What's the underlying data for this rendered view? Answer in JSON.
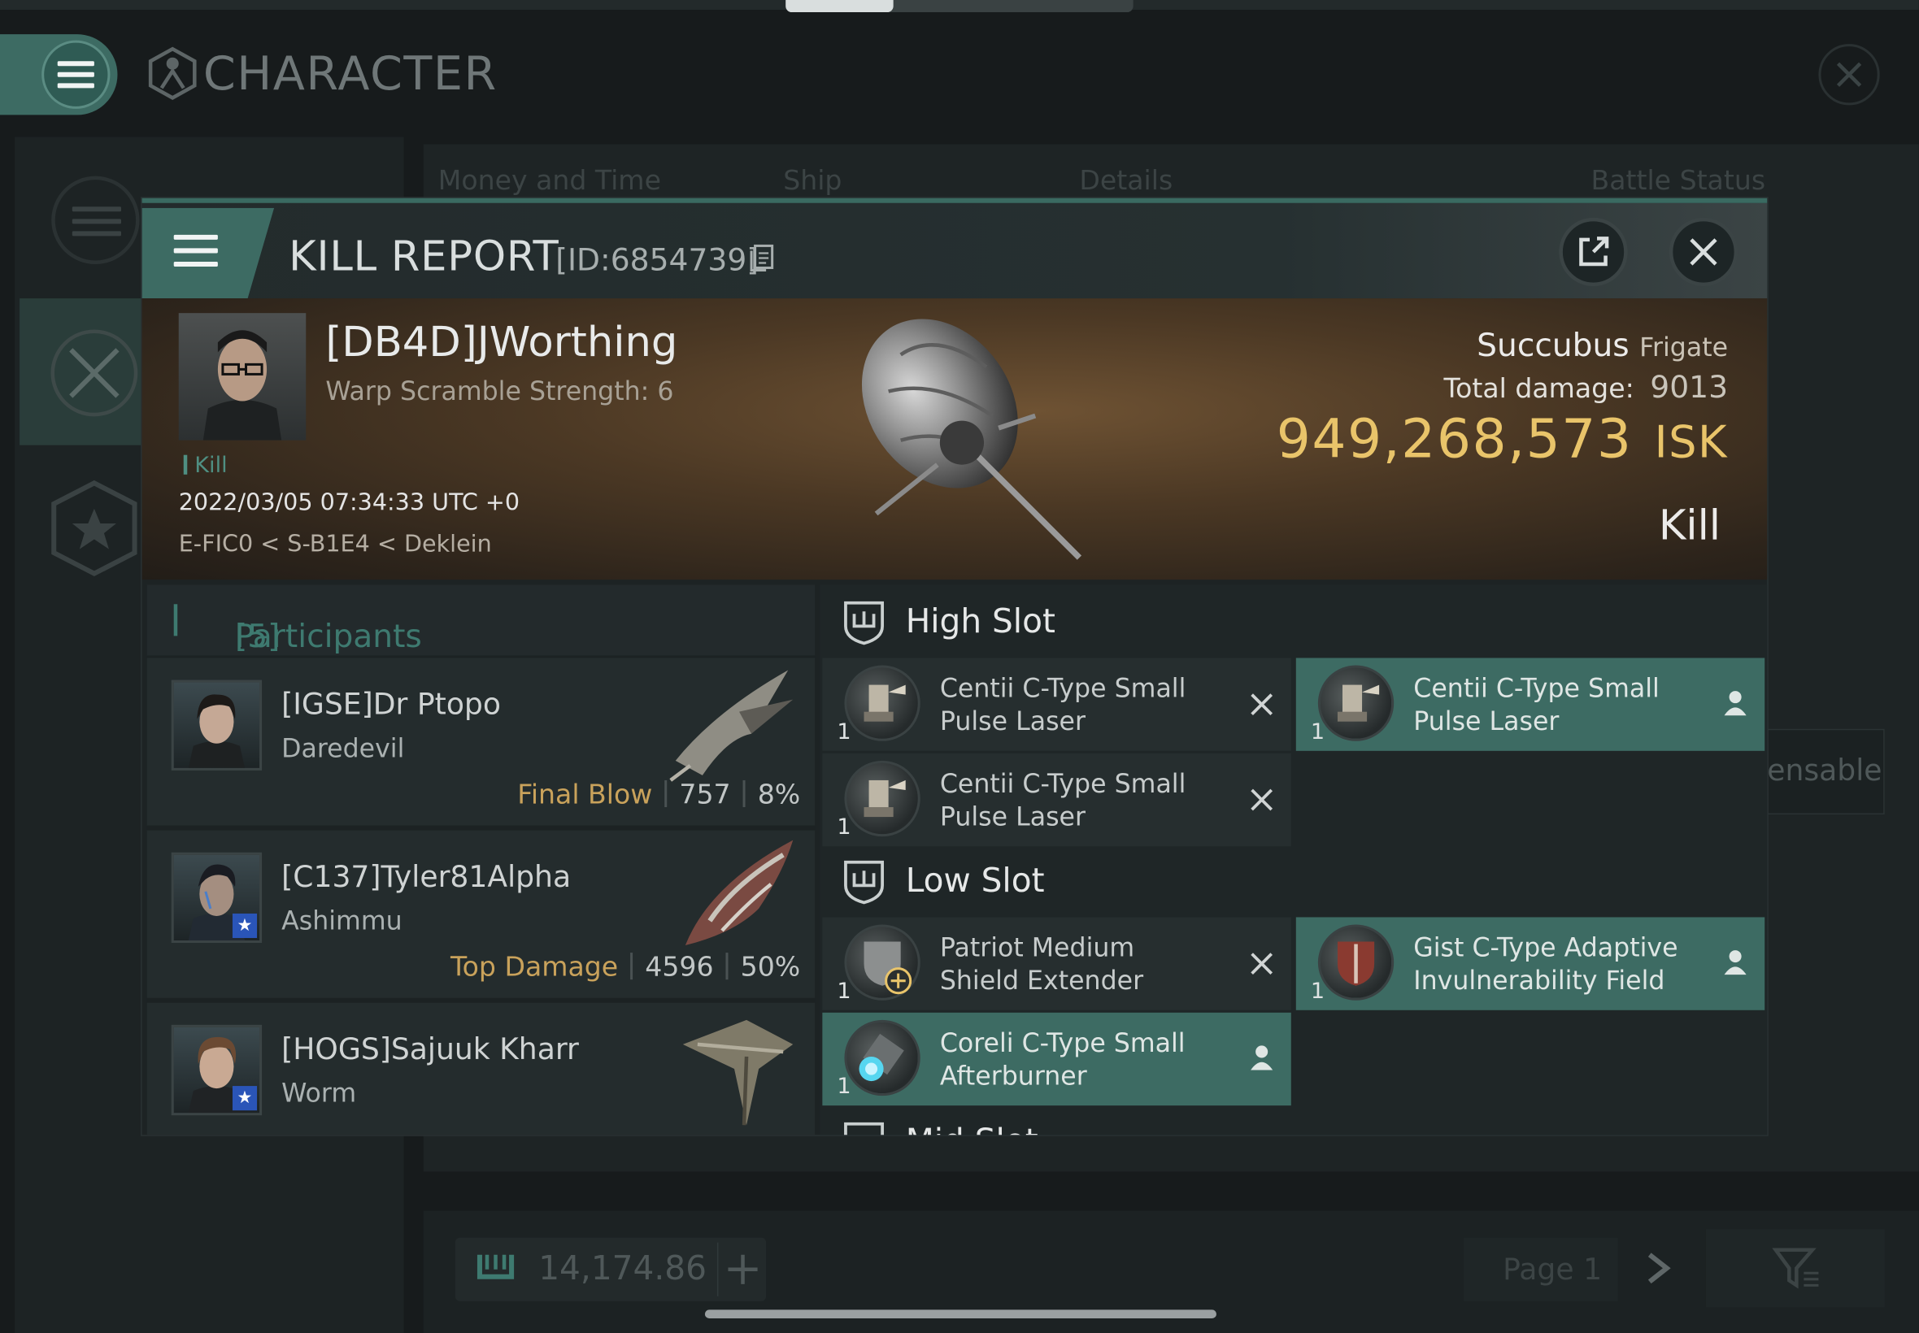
{
  "app": {
    "title": "CHARACTER"
  },
  "background": {
    "tabs": [
      "Money and Time",
      "Ship",
      "Details",
      "Battle Status"
    ],
    "side_label": "ensable",
    "isk_total": "14,174.86",
    "page_label": "Page 1"
  },
  "modal": {
    "title": "KILL REPORT",
    "id": "[ID:6854739]"
  },
  "victim": {
    "name": "[DB4D]JWorthing",
    "subtitle": "Warp Scramble Strength: 6",
    "kill_tag": "Kill",
    "datetime": "2022/03/05 07:34:33 UTC +0",
    "location": "E-FIC0 < S-B1E4 < Deklein",
    "ship": "Succubus",
    "ship_class": "Frigate",
    "damage_label": "Total damage:",
    "damage_value": "9013",
    "isk_value": "949,268,573",
    "isk_unit": "ISK",
    "result": "Kill"
  },
  "participants": {
    "label": "Participants",
    "count": "[5]",
    "rows": [
      {
        "name": "[IGSE]Dr Ptopo",
        "ship": "Daredevil",
        "tag": "Final Blow",
        "damage": "757",
        "percent": "8%"
      },
      {
        "name": "[C137]Tyler81Alpha",
        "ship": "Ashimmu",
        "tag": "Top Damage",
        "damage": "4596",
        "percent": "50%"
      },
      {
        "name": "[HOGS]Sajuuk Kharr",
        "ship": "Worm",
        "tag": "",
        "damage": "",
        "percent": ""
      }
    ]
  },
  "fitting": {
    "high_slot_label": "High Slot",
    "low_slot_label": "Low Slot",
    "mid_slot_label": "Mid Slot",
    "high": [
      {
        "name": "Centii C-Type Small Pulse Laser",
        "qty": "1",
        "state": "destroyed"
      },
      {
        "name": "Centii C-Type Small Pulse Laser",
        "qty": "1",
        "state": "dropped"
      },
      {
        "name": "Centii C-Type Small Pulse Laser",
        "qty": "1",
        "state": "destroyed"
      }
    ],
    "low": [
      {
        "name": "Patriot Medium Shield Extender",
        "qty": "1",
        "state": "destroyed"
      },
      {
        "name": "Gist C-Type Adaptive Invulnerability Field",
        "qty": "1",
        "state": "dropped"
      },
      {
        "name": "Coreli C-Type Small Afterburner",
        "qty": "1",
        "state": "dropped"
      }
    ]
  },
  "colors": {
    "accent": "#3d6b63",
    "isk": "#e9c46a",
    "label_gold": "#c9a25b"
  }
}
